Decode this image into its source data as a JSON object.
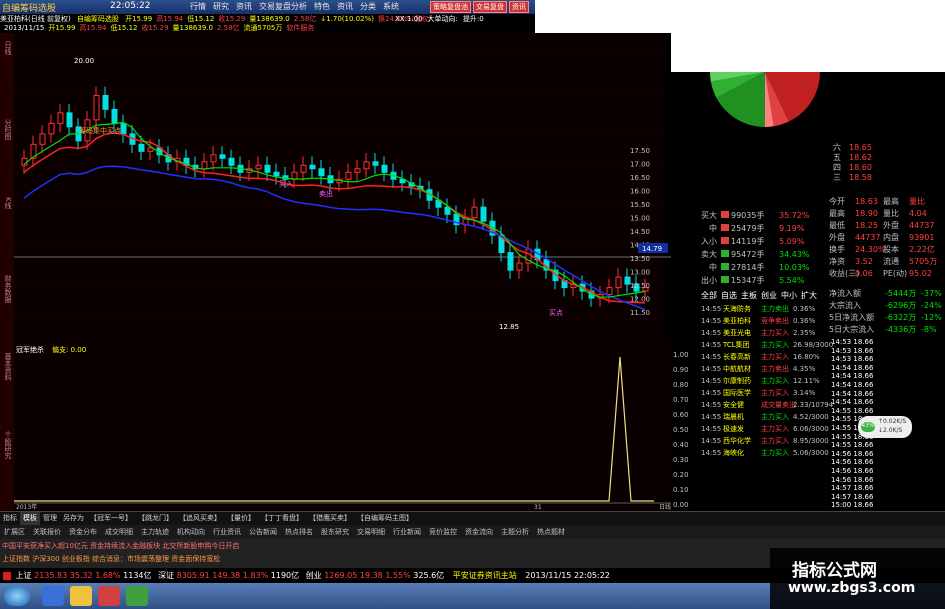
{
  "titlebar": {
    "app_name": "自编筹码选股",
    "clock": "22:05:22",
    "menu": [
      "行情",
      "研究",
      "资讯",
      "交易复盘分析",
      "特色",
      "资讯",
      "分类",
      "系统"
    ],
    "window_buttons": [
      "策略复盘池",
      "交易复盘",
      "资讯"
    ]
  },
  "info": {
    "stock_name": "美亚柏科(日线 前复权)",
    "indicator_label": "自编筹码选股",
    "line1_items": [
      "开15.99",
      "高15.94",
      "低15.12",
      "收15.29",
      "量138639.0",
      "2.58亿",
      "↓1.70(10.02%)",
      "换24.30%(复权)"
    ],
    "line2_items": [
      "2013/11/15",
      "开15.99",
      "高15.94",
      "低15.12",
      "收15.29",
      "量138639.0",
      "2.58亿",
      "流通5705万",
      "软件服务"
    ],
    "right_items": [
      "XX:1.00",
      "大单动向:",
      "提升:0"
    ]
  },
  "left_tabs": [
    "日线",
    "分时图",
    "K线",
    "财务数据",
    "基本资料",
    "个股研究"
  ],
  "chart": {
    "price_axis": [
      "17.50",
      "17.00",
      "16.50",
      "16.00",
      "15.50",
      "15.00",
      "14.50",
      "14.00",
      "13.50",
      "13.00",
      "12.50",
      "12.00",
      "11.50"
    ],
    "current_price_tag": "14.79",
    "annotations": {
      "high": "20.00",
      "low": "12.85",
      "buy1": "买入",
      "buy2": "卖出",
      "buy3": "买点",
      "top": "筹码集中买点"
    },
    "indicator_title": "冠军绝杀",
    "indicator_value": "偏支: 0.00",
    "ind_axis": [
      "1.00",
      "0.90",
      "0.80",
      "0.70",
      "0.60",
      "0.50",
      "0.40",
      "0.30",
      "0.20",
      "0.10",
      "0.00"
    ],
    "xaxis_label": "2013年",
    "xaxis_tag": "31",
    "xaxis_right": "日线"
  },
  "quote": {
    "buysell_rows": [
      {
        "side": "买",
        "level": "大",
        "vol": "99035手",
        "pct": "35.72%"
      },
      {
        "side": "",
        "level": "中",
        "vol": "25479手",
        "pct": "9.19%"
      },
      {
        "side": "入",
        "level": "小",
        "vol": "14119手",
        "pct": "5.09%"
      },
      {
        "side": "卖",
        "level": "大",
        "vol": "95472手",
        "pct": "34.43%"
      },
      {
        "side": "",
        "level": "中",
        "vol": "27814手",
        "pct": "10.03%"
      },
      {
        "side": "出",
        "level": "小",
        "vol": "15347手",
        "pct": "5.54%"
      }
    ],
    "tabs_mid": [
      "全部",
      "自选",
      "主板",
      "创业",
      "中小",
      "扩大"
    ],
    "order_book": [
      {
        "label": "六",
        "price": "18.65"
      },
      {
        "label": "五",
        "price": "18.62"
      },
      {
        "label": "四",
        "price": "18.60"
      },
      {
        "label": "三",
        "price": "18.58"
      }
    ],
    "stats": [
      [
        "今开",
        "18.63",
        "最高",
        "量比"
      ],
      [
        "最高",
        "18.90",
        "量比",
        "4.04"
      ],
      [
        "最低",
        "18.25",
        "外盘",
        "44737"
      ],
      [
        "外盘",
        "44737",
        "内盘",
        "93901"
      ],
      [
        "换手",
        "24.30%",
        "股本",
        "2.22亿"
      ],
      [
        "净资",
        "3.52",
        "流通",
        "5705万"
      ],
      [
        "收益(三)",
        "0.06",
        "PE(动)",
        "95.02"
      ]
    ],
    "flows": [
      [
        "净流入额",
        "-5444万",
        "-37%"
      ],
      [
        "大宗流入",
        "-6296万",
        "-24%"
      ],
      [
        "5日净流入额",
        "-6322万",
        "-12%"
      ],
      [
        "5日大宗流入",
        "-4336万",
        "-8%"
      ]
    ],
    "ticks": [
      "14:53 18.66",
      "14:53 18.66",
      "14:53 18.66",
      "14:54 18.66",
      "14:54 18.66",
      "14:54 18.66",
      "14:54 18.66",
      "14:54 18.66",
      "14:55 18.66",
      "14:55 18.66",
      "14:55 18.66",
      "14:55 18.66",
      "14:55 18.66",
      "14:56 18.66",
      "14:56 18.66",
      "14:56 18.66",
      "14:56 18.66",
      "14:57 18.66",
      "14:57 18.66",
      "15:00 18.66"
    ],
    "news_list": [
      {
        "time": "14:55",
        "name": "天海防务",
        "tag": "主力卖出",
        "v": "0.36%"
      },
      {
        "time": "14:55",
        "name": "美亚柏科",
        "tag": "竞争卖出",
        "v": "0.36%"
      },
      {
        "time": "14:55",
        "name": "美亚光电",
        "tag": "主力买入",
        "v": "2.35%"
      },
      {
        "time": "14:55",
        "name": "TCL集团",
        "tag": "主力买入",
        "v": "26.98/3000"
      },
      {
        "time": "14:55",
        "name": "长春高新",
        "tag": "主力买入",
        "v": "16.80%"
      },
      {
        "time": "14:55",
        "name": "中航航材",
        "tag": "主力卖出",
        "v": "4.35%"
      },
      {
        "time": "14:55",
        "name": "尔康制药",
        "tag": "主力买入",
        "v": "12.11%"
      },
      {
        "time": "14:55",
        "name": "国际医学",
        "tag": "主力买入",
        "v": "3.14%"
      },
      {
        "time": "14:55",
        "name": "安全健",
        "tag": "成交量卖出",
        "v": "2.33/10794"
      },
      {
        "time": "14:55",
        "name": "瑞晨机",
        "tag": "主力买入",
        "v": "4.52/3000"
      },
      {
        "time": "14:55",
        "name": "极速发",
        "tag": "主力买入",
        "v": "6.06/3000"
      },
      {
        "time": "14:55",
        "name": "西华化学",
        "tag": "主力买入",
        "v": "8.95/3000"
      },
      {
        "time": "14:55",
        "name": "海峡化",
        "tag": "主力买入",
        "v": "5.06/3000"
      }
    ],
    "float_badge": [
      "↑0.02K/S",
      "↓2.0K/S"
    ],
    "float_pct": "43%"
  },
  "tabrow": [
    "指标",
    "模板",
    "管理",
    "另存为",
    "【冠军一号】",
    "【跳龙门】",
    "【追风买卖】",
    "【量价】",
    "【丁丁看盘】",
    "【猎鹰买卖】",
    "【自编筹码主图】"
  ],
  "tabrow_active_index": 1,
  "subrow": [
    "扩展区",
    "关联报价",
    "资金分布",
    "成交明细",
    "主力轨迹",
    "机构动向",
    "行业资讯",
    "公告新闻",
    "热点排名",
    "股东研究",
    "交易明细",
    "行业新闻",
    "竞价监控",
    "资金流向",
    "主题分析",
    "热点题材"
  ],
  "news1": "中国平安获净买入超10亿元 资金持续流入金融板块 北交所新股申购今日开启",
  "news2": "上证指数 沪深300 创业板指 综合消息：市场震荡整理 资金面保持宽松",
  "status": {
    "sh_label": "上证",
    "sh_value": "2135.83",
    "sh_change": "35.32",
    "sh_pct": "1.68%",
    "sh_amount": "1134亿",
    "sz_label": "深证",
    "sz_value": "8305.91",
    "sz_change": "149.38",
    "sz_pct": "1.83%",
    "sz_amount": "1190亿",
    "cy_label": "创业",
    "cy_value": "1269.05",
    "cy_change": "19.38",
    "cy_pct": "1.55%",
    "cy_amount": "325.6亿",
    "server": "平安证券资讯主站",
    "date": "2013/11/15",
    "time": "22:05:22"
  },
  "watermark": {
    "line1": "指标公式网",
    "line2": "www.zbgs3.com"
  },
  "colors": {
    "red": "#ff3030",
    "green": "#00e000",
    "yellow": "#ffff00",
    "blue": "#3040ff",
    "bg": "#000000"
  }
}
